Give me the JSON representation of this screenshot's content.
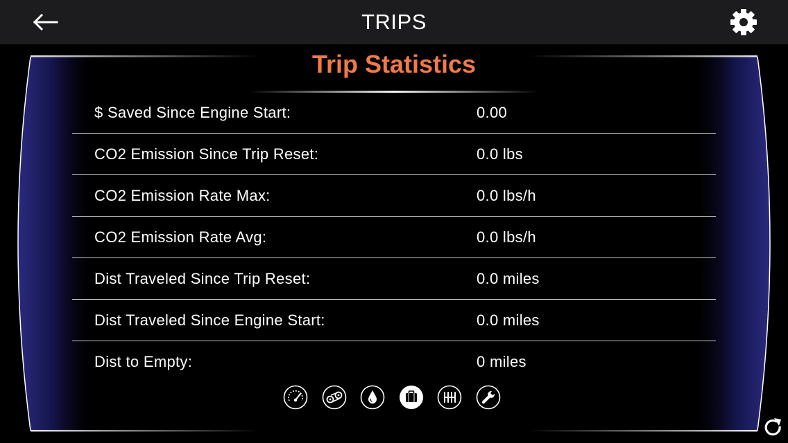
{
  "header": {
    "title": "TRIPS",
    "back_icon": "back-arrow-icon",
    "settings_icon": "gear-icon"
  },
  "section": {
    "title": "Trip Statistics"
  },
  "stats": [
    {
      "label": "$ Saved Since Engine Start:",
      "value": "0.00"
    },
    {
      "label": "CO2 Emission Since Trip Reset:",
      "value": "0.0 lbs"
    },
    {
      "label": "CO2 Emission Rate Max:",
      "value": "0.0 lbs/h"
    },
    {
      "label": "CO2 Emission Rate Avg:",
      "value": "0.0 lbs/h"
    },
    {
      "label": "Dist Traveled Since Trip Reset:",
      "value": "0.0 miles"
    },
    {
      "label": "Dist Traveled Since Engine Start:",
      "value": "0.0 miles"
    },
    {
      "label": "Dist to Empty:",
      "value": "0 miles"
    }
  ],
  "pager": {
    "items": [
      "gauge-icon",
      "drivetrain-icon",
      "fuel-drop-icon",
      "suitcase-icon",
      "gear-shift-icon",
      "wrench-icon"
    ],
    "active": "suitcase-icon"
  },
  "refresh_icon": "refresh-icon",
  "colors": {
    "accent": "#f07a4a",
    "topbar": "#1c1c1e",
    "frame_glow": "#24246e",
    "background": "#000000"
  }
}
